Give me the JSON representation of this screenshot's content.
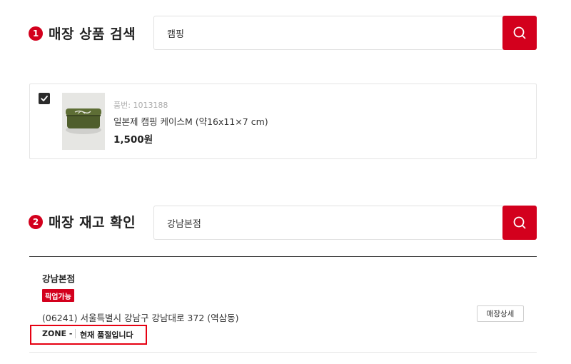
{
  "section1": {
    "number": "1",
    "title": "매장 상품 검색",
    "search_value": "캠핑",
    "search_button_icon": "search-icon"
  },
  "product": {
    "checked": true,
    "code": "품번: 1013188",
    "name": "일본제 캠핑 케이스M (약16x11×7 cm)",
    "price": "1,500원"
  },
  "section2": {
    "number": "2",
    "title": "매장 재고 확인",
    "search_value": "강남본점",
    "search_button_icon": "search-icon"
  },
  "store": {
    "name": "강남본점",
    "badge": "픽업가능",
    "address": "(06241) 서울특별시 강남구 강남대로 372 (역삼동)",
    "zone": "ZONE -",
    "stock_status": "현재 품절입니다",
    "detail_button": "매장상세"
  },
  "colors": {
    "accent": "#d3001d",
    "highlight_border": "#e60012",
    "checkbox": "#2b2b2b"
  }
}
